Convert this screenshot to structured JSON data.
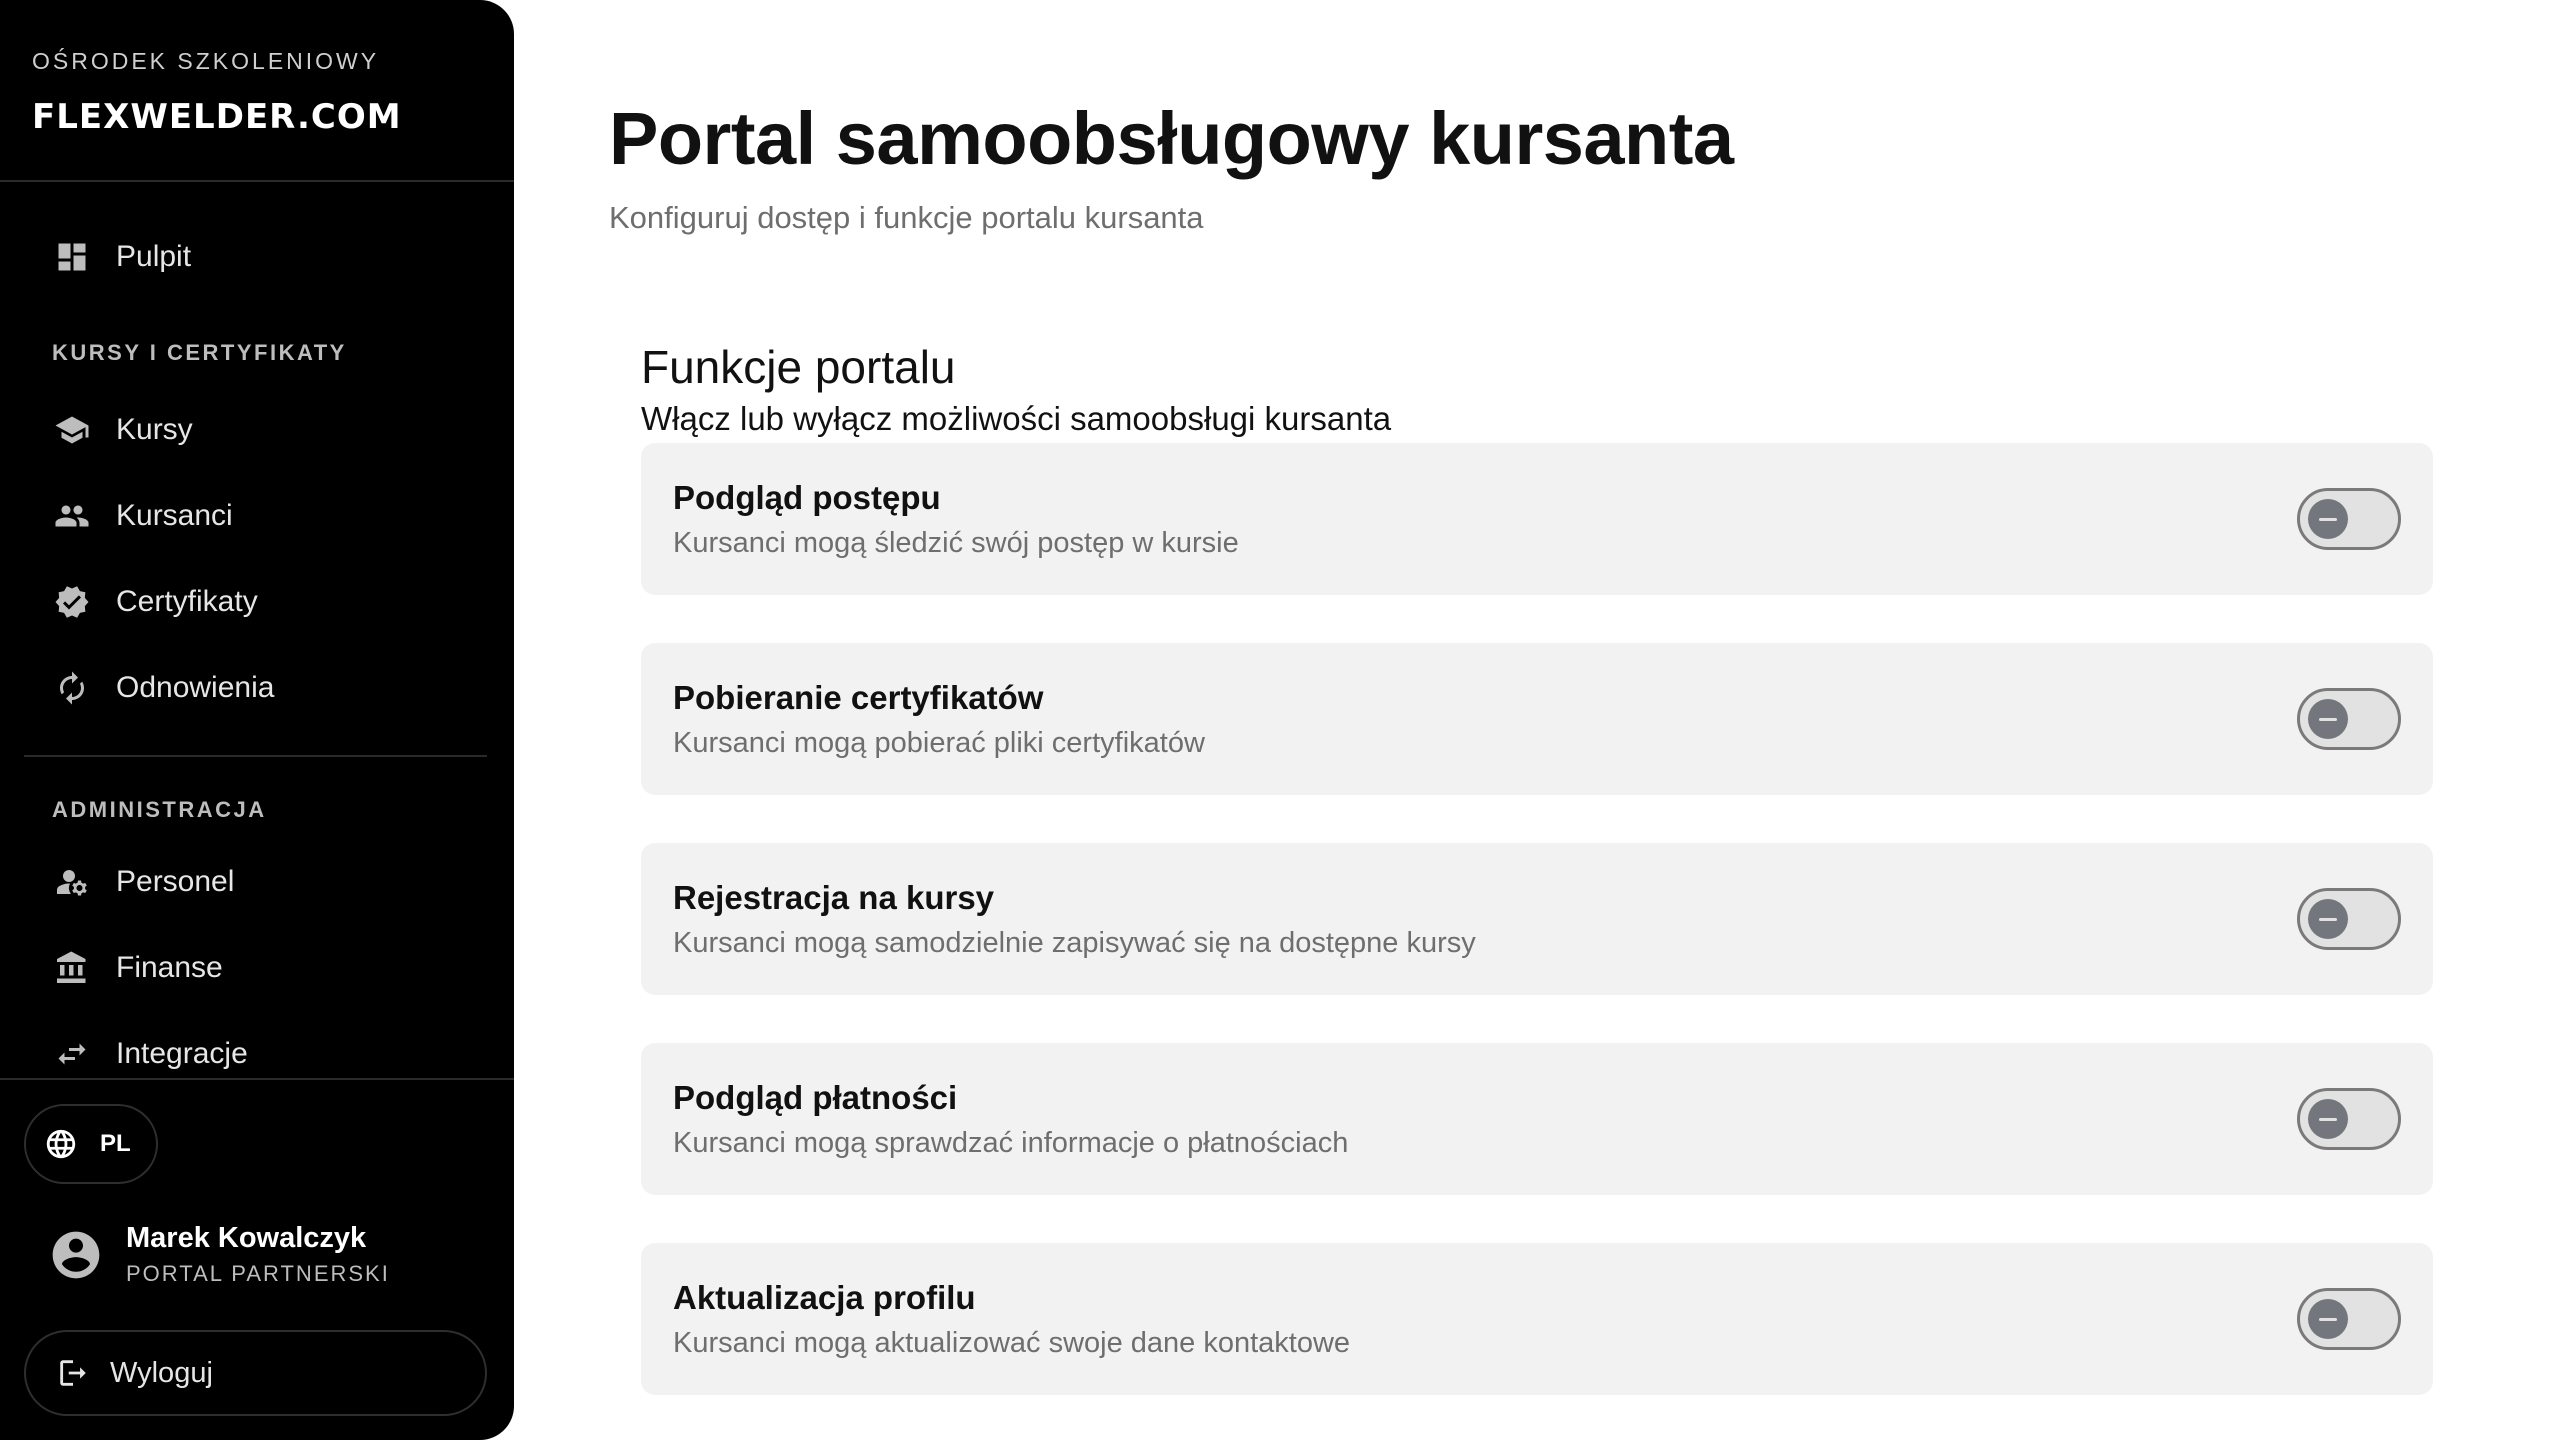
{
  "sidebar": {
    "brand_small": "OŚRODEK SZKOLENIOWY",
    "brand_logo": "FLEXWELDER.COM",
    "items": {
      "pulpit": "Pulpit",
      "kursy": "Kursy",
      "kursanci": "Kursanci",
      "certyfikaty": "Certyfikaty",
      "odnowienia": "Odnowienia",
      "personel": "Personel",
      "finanse": "Finanse",
      "integracje": "Integracje"
    },
    "sections": {
      "courses": "KURSY I CERTYFIKATY",
      "admin": "ADMINISTRACJA"
    },
    "language": "PL",
    "user": {
      "name": "Marek Kowalczyk",
      "role": "PORTAL PARTNERSKI"
    },
    "logout": "Wyloguj",
    "icons": [
      "dashboard-icon",
      "school-icon",
      "group-icon",
      "verified-badge-icon",
      "refresh-icon",
      "manage-accounts-icon",
      "bank-icon",
      "swap-arrows-icon",
      "globe-icon",
      "account-circle-icon",
      "logout-icon"
    ]
  },
  "main": {
    "title": "Portal samoobsługowy kursanta",
    "subtitle": "Konfiguruj dostęp i funkcje portalu kursanta",
    "section": {
      "title": "Funkcje portalu",
      "subtitle": "Włącz lub wyłącz możliwości samoobsługi kursanta"
    },
    "features": [
      {
        "title": "Podgląd postępu",
        "description": "Kursanci mogą śledzić swój postęp w kursie",
        "enabled": false
      },
      {
        "title": "Pobieranie certyfikatów",
        "description": "Kursanci mogą pobierać pliki certyfikatów",
        "enabled": false
      },
      {
        "title": "Rejestracja na kursy",
        "description": "Kursanci mogą samodzielnie zapisywać się na dostępne kursy",
        "enabled": false
      },
      {
        "title": "Podgląd płatności",
        "description": "Kursanci mogą sprawdzać informacje o płatnościach",
        "enabled": false
      },
      {
        "title": "Aktualizacja profilu",
        "description": "Kursanci mogą aktualizować swoje dane kontaktowe",
        "enabled": false
      }
    ]
  },
  "colors": {
    "sidebar_bg": "#000000",
    "card_bg": "#f2f2f2",
    "toggle_off_track": "#e2e2e2",
    "toggle_off_knob": "#73767c",
    "muted_text": "#6e6e6e"
  }
}
